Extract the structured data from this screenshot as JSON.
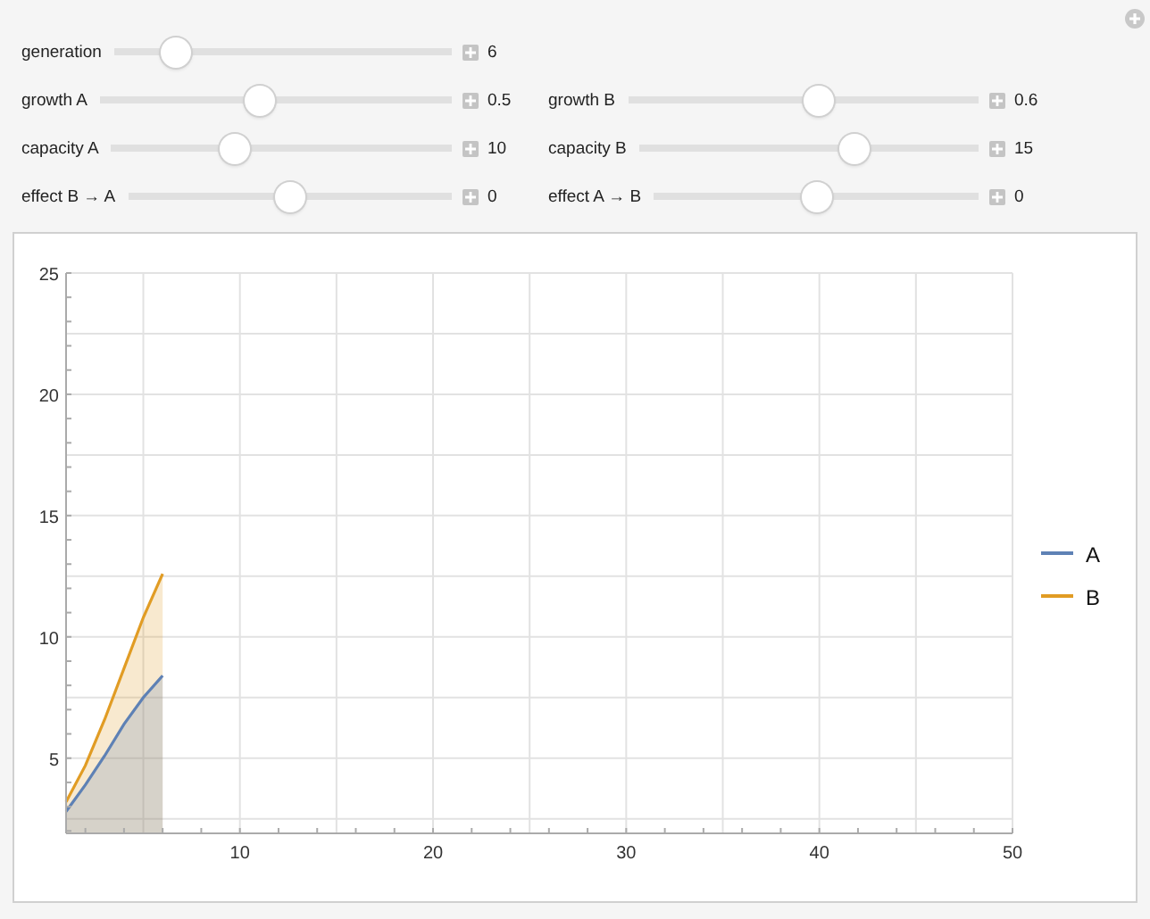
{
  "rows": [
    {
      "controls": [
        {
          "label": "generation",
          "level": 0.15,
          "value": "6"
        }
      ]
    },
    {
      "controls": [
        {
          "label": "growth A",
          "level": 0.45,
          "value": "0.5"
        },
        {
          "label": "growth B",
          "level": 0.55,
          "value": "0.6"
        }
      ]
    },
    {
      "controls": [
        {
          "label": "capacity A",
          "level": 0.35,
          "value": "10"
        },
        {
          "label": "capacity B",
          "level": 0.65,
          "value": "15"
        }
      ]
    },
    {
      "controls": [
        {
          "label": "effect B → A",
          "level": 0.5,
          "value": "0"
        },
        {
          "label": "effect A → B",
          "level": 0.5,
          "value": "0"
        }
      ]
    }
  ],
  "plot": {
    "chart_data": {
      "type": "area",
      "grid": true,
      "legend": true,
      "x": [
        1,
        2,
        3,
        4,
        5,
        6
      ],
      "xlim": [
        1,
        50
      ],
      "ylim": [
        1.9,
        25
      ],
      "xticks": [
        10,
        20,
        30,
        40,
        50
      ],
      "yticks": [
        5,
        10,
        15,
        20,
        25
      ],
      "series": [
        {
          "name": "A",
          "color": "#5e81b5",
          "values": [
            2.8,
            3.9,
            5.1,
            6.4,
            7.5,
            8.4
          ]
        },
        {
          "name": "B",
          "color": "#e19c24",
          "values": [
            3.2,
            4.7,
            6.6,
            8.7,
            10.8,
            12.6
          ]
        }
      ]
    }
  }
}
